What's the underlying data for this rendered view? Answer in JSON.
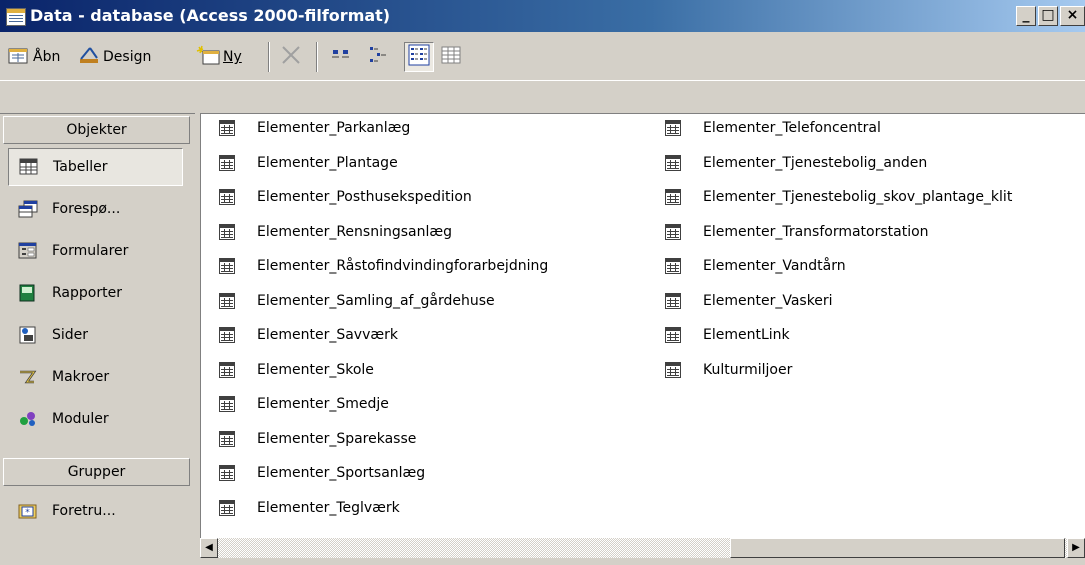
{
  "window": {
    "title": "Data - database (Access 2000-filformat)"
  },
  "titlebar_buttons": {
    "minimize": "_",
    "maximize": "□",
    "close": "×"
  },
  "toolbar": {
    "open_label": "Åbn",
    "design_label": "Design",
    "new_label": "Ny"
  },
  "sidebar": {
    "objects_header": "Objekter",
    "items": [
      {
        "label": "Tabeller",
        "icon": "table-icon",
        "selected": true
      },
      {
        "label": "Forespø...",
        "icon": "query-icon"
      },
      {
        "label": "Formularer",
        "icon": "form-icon"
      },
      {
        "label": "Rapporter",
        "icon": "report-icon"
      },
      {
        "label": "Sider",
        "icon": "page-icon"
      },
      {
        "label": "Makroer",
        "icon": "macro-icon"
      },
      {
        "label": "Moduler",
        "icon": "module-icon"
      }
    ],
    "groups_header": "Grupper",
    "group_items": [
      {
        "label": "Foretru...",
        "icon": "favorites-icon"
      }
    ]
  },
  "list": {
    "column1": [
      "Elementer_Parkanlæg",
      "Elementer_Plantage",
      "Elementer_Posthusekspedition",
      "Elementer_Rensningsanlæg",
      "Elementer_Råstofindvindingforarbejdning",
      "Elementer_Samling_af_gårdehuse",
      "Elementer_Savværk",
      "Elementer_Skole",
      "Elementer_Smedje",
      "Elementer_Sparekasse",
      "Elementer_Sportsanlæg",
      "Elementer_Teglværk"
    ],
    "column2": [
      "Elementer_Telefoncentral",
      "Elementer_Tjenestebolig_anden",
      "Elementer_Tjenestebolig_skov_plantage_klit",
      "Elementer_Transformatorstation",
      "Elementer_Vandtårn",
      "Elementer_Vaskeri",
      "ElementLink",
      "Kulturmiljoer"
    ]
  }
}
